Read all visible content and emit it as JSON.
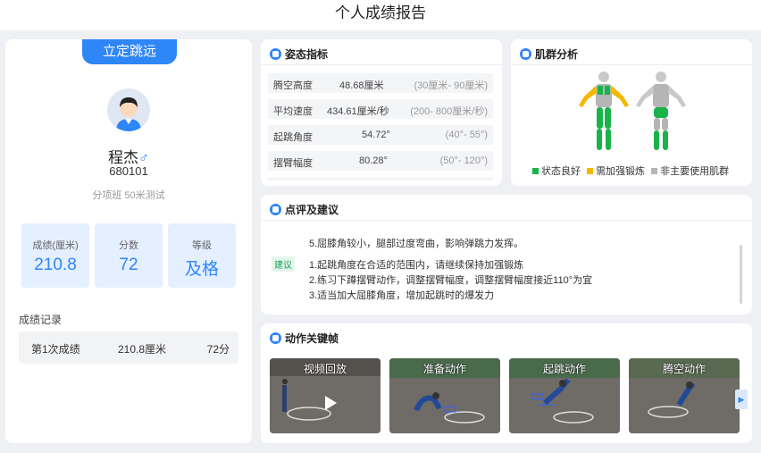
{
  "header": {
    "title": "个人成绩报告"
  },
  "student": {
    "event": "立定跳远",
    "name": "程杰",
    "gender_symbol": "♂",
    "id": "680101",
    "class_info": "分项班 50米测试"
  },
  "stats": [
    {
      "label": "成绩(厘米)",
      "value": "210.8"
    },
    {
      "label": "分数",
      "value": "72"
    },
    {
      "label": "等级",
      "value": "及格"
    }
  ],
  "records": {
    "title": "成绩记录",
    "rows": [
      {
        "label": "第1次成绩",
        "distance": "210.8厘米",
        "score": "72分"
      }
    ]
  },
  "posture": {
    "title": "姿态指标",
    "rows": [
      {
        "name": "腾空高度",
        "value": "48.68厘米",
        "range": "(30厘米- 90厘米)"
      },
      {
        "name": "平均速度",
        "value": "434.61厘米/秒",
        "range": "(200- 800厘米/秒)"
      },
      {
        "name": "起跳角度",
        "value": "54.72°",
        "range": "(40°- 55°)"
      },
      {
        "name": "摆臂幅度",
        "value": "80.28°",
        "range": "(50°- 120°)"
      }
    ]
  },
  "muscle": {
    "title": "肌群分析",
    "legend": [
      {
        "label": "状态良好",
        "color": "#19b34a"
      },
      {
        "label": "需加强锻炼",
        "color": "#f5b800"
      },
      {
        "label": "非主要使用肌群",
        "color": "#b5b5b5"
      }
    ]
  },
  "comment": {
    "title": "点评及建议",
    "problem_line": "5.屈膝角较小，腿部过度弯曲，影响弹跳力发挥。",
    "advice_tag": "建议",
    "advice": [
      "1.起跳角度在合适的范围内，请继续保持加强锻炼",
      "2.练习下蹲摆臂动作，调整摆臂幅度，调整摆臂幅度接近110°为宜",
      "3.适当加大屈膝角度，增加起跳时的爆发力"
    ]
  },
  "keyframes": {
    "title": "动作关键帧",
    "items": [
      {
        "label": "视频回放"
      },
      {
        "label": "准备动作"
      },
      {
        "label": "起跳动作"
      },
      {
        "label": "腾空动作"
      }
    ]
  },
  "colors": {
    "accent": "#2f86f6",
    "good": "#19b34a",
    "warn": "#f5b800",
    "neutral": "#b5b5b5"
  }
}
